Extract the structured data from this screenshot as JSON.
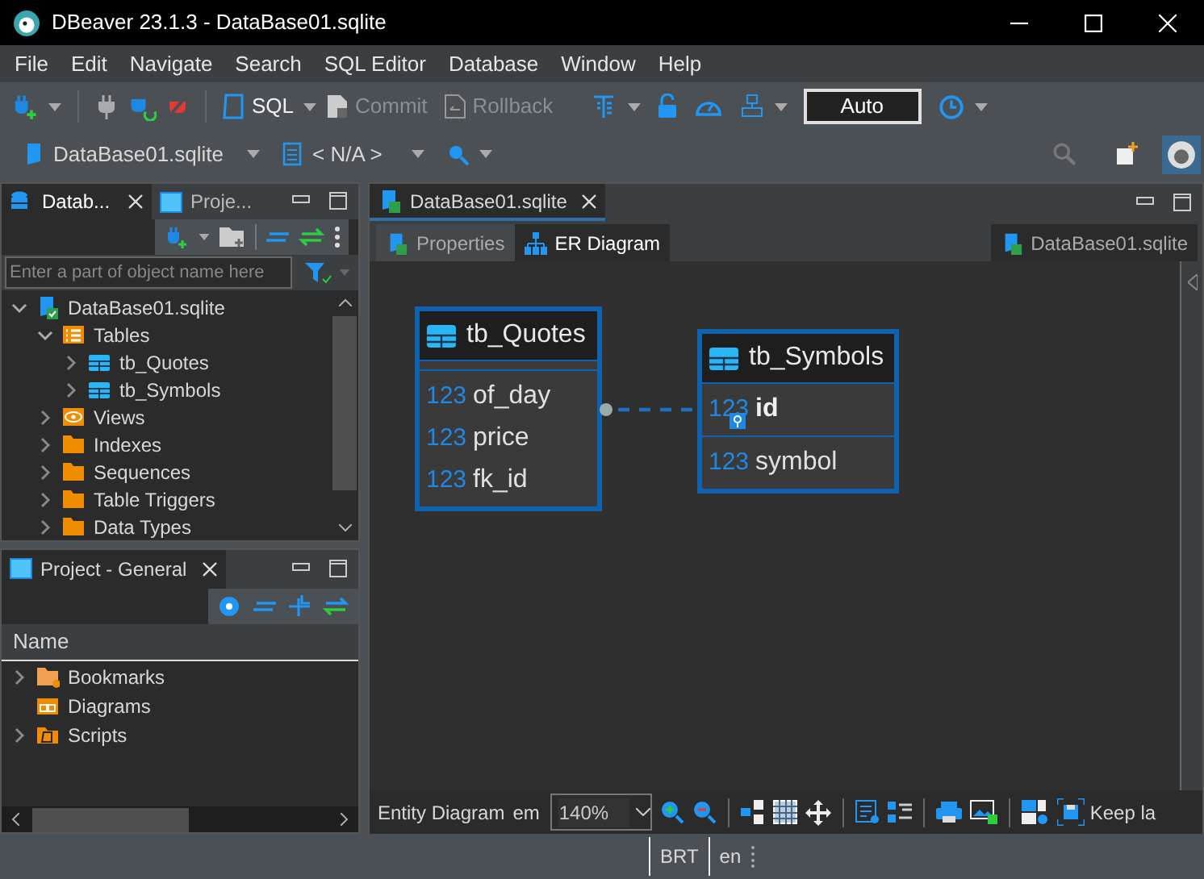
{
  "window": {
    "title": "DBeaver 23.1.3 - DataBase01.sqlite"
  },
  "menu": [
    "File",
    "Edit",
    "Navigate",
    "Search",
    "SQL Editor",
    "Database",
    "Window",
    "Help"
  ],
  "toolbar": {
    "sql_button": {
      "label": "SQL",
      "disabled": false
    },
    "commit_button": {
      "label": "Commit",
      "disabled": true
    },
    "rollback_button": {
      "label": "Rollback",
      "disabled": true
    },
    "transaction_mode": "Auto"
  },
  "context_bar": {
    "connection": "DataBase01.sqlite",
    "schema": "< N/A >"
  },
  "navigator": {
    "tabs": [
      {
        "label": "Datab...",
        "selected": true
      },
      {
        "label": "Proje...",
        "selected": false
      }
    ],
    "search": {
      "placeholder": "Enter a part of object name here"
    },
    "tree": [
      {
        "label": "DataBase01.sqlite",
        "kind": "database",
        "expanded": true,
        "children": [
          {
            "label": "Tables",
            "kind": "tables",
            "expanded": true,
            "children": [
              {
                "label": "tb_Quotes",
                "kind": "table",
                "expanded": false
              },
              {
                "label": "tb_Symbols",
                "kind": "table",
                "expanded": false
              }
            ]
          },
          {
            "label": "Views",
            "kind": "views",
            "expanded": false
          },
          {
            "label": "Indexes",
            "kind": "folder",
            "expanded": false
          },
          {
            "label": "Sequences",
            "kind": "folder",
            "expanded": false
          },
          {
            "label": "Table Triggers",
            "kind": "folder",
            "expanded": false
          },
          {
            "label": "Data Types",
            "kind": "folder",
            "expanded": false
          }
        ]
      }
    ]
  },
  "project": {
    "tab": "Project - General",
    "column": "Name",
    "items": [
      {
        "label": "Bookmarks",
        "kind": "bookmarks",
        "expandable": true
      },
      {
        "label": "Diagrams",
        "kind": "diagrams",
        "expandable": false
      },
      {
        "label": "Scripts",
        "kind": "scripts",
        "expandable": true
      }
    ]
  },
  "editor": {
    "tab": "DataBase01.sqlite",
    "subtabs": [
      {
        "label": "Properties",
        "selected": false
      },
      {
        "label": "ER Diagram",
        "selected": true
      }
    ],
    "datasource": "DataBase01.sqlite",
    "entities": [
      {
        "name": "tb_Quotes",
        "columns": [
          {
            "type": "123",
            "name": "of_day",
            "key": false
          },
          {
            "type": "123",
            "name": "price",
            "key": false
          },
          {
            "type": "123",
            "name": "fk_id",
            "key": false
          }
        ]
      },
      {
        "name": "tb_Symbols",
        "columns": [
          {
            "type": "123",
            "name": "id",
            "key": true
          },
          {
            "type": "123",
            "name": "symbol",
            "key": false
          }
        ]
      }
    ],
    "bottom_bar": {
      "label": "Entity Diagram",
      "unit": "em",
      "zoom": "140%",
      "keep_layout": "Keep la"
    }
  },
  "status_bar": [
    "BRT",
    "en"
  ]
}
